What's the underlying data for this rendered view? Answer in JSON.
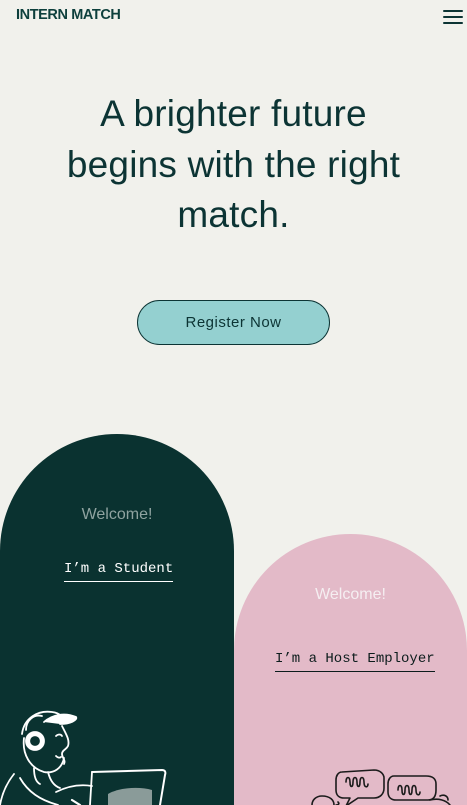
{
  "header": {
    "logo_text": "INTERN MATCH",
    "menu_icon": "hamburger-menu-icon"
  },
  "hero": {
    "title": "A brighter future begins with the right match.",
    "cta_label": "Register Now"
  },
  "cards": {
    "student": {
      "welcome": "Welcome!",
      "link_label": "I’m a Student",
      "illustration": "student-with-laptop-illustration"
    },
    "employer": {
      "welcome": "Welcome!",
      "link_label": "I’m a Host Employer",
      "illustration": "speech-bubbles-illustration"
    }
  },
  "colors": {
    "background": "#f1f1ec",
    "text_dark": "#0c3434",
    "cta_fill": "#94d0d0",
    "student_card": "#0a3230",
    "employer_card": "#e3bac8"
  }
}
